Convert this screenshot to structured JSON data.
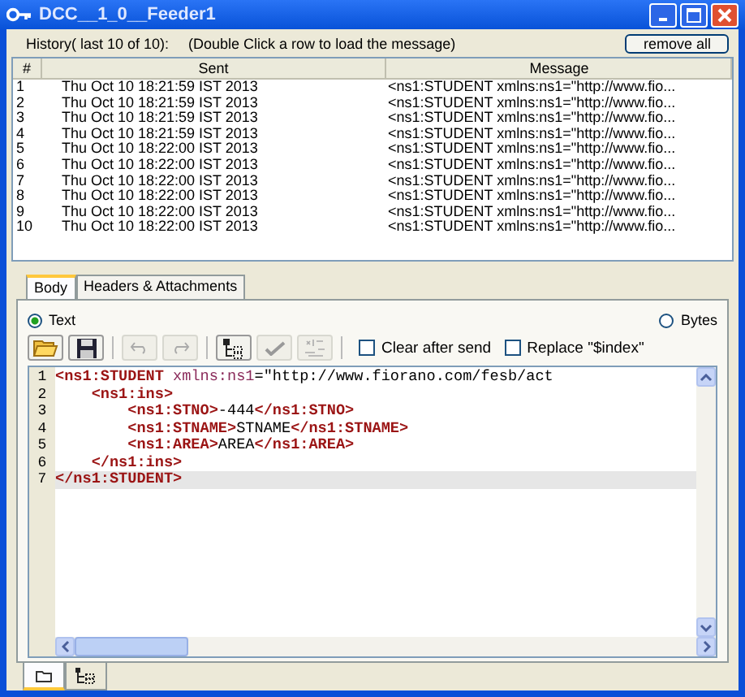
{
  "window": {
    "title": "DCC__1_0__Feeder1",
    "controls": [
      {
        "kind": "minimize"
      },
      {
        "kind": "maximize"
      },
      {
        "kind": "close"
      }
    ]
  },
  "history": {
    "label": "History( last 10 of 10):",
    "hint": "(Double Click a row to load the message)",
    "button": "remove all"
  },
  "table": {
    "columns": [
      "#",
      "Sent",
      "Message"
    ],
    "rows": [
      {
        "num": "1",
        "sent": "Thu Oct 10 18:21:59 IST 2013",
        "message": "<ns1:STUDENT xmlns:ns1=\"http://www.fio..."
      },
      {
        "num": "2",
        "sent": "Thu Oct 10 18:21:59 IST 2013",
        "message": "<ns1:STUDENT xmlns:ns1=\"http://www.fio..."
      },
      {
        "num": "3",
        "sent": "Thu Oct 10 18:21:59 IST 2013",
        "message": "<ns1:STUDENT xmlns:ns1=\"http://www.fio..."
      },
      {
        "num": "4",
        "sent": "Thu Oct 10 18:21:59 IST 2013",
        "message": "<ns1:STUDENT xmlns:ns1=\"http://www.fio..."
      },
      {
        "num": "5",
        "sent": "Thu Oct 10 18:22:00 IST 2013",
        "message": "<ns1:STUDENT xmlns:ns1=\"http://www.fio..."
      },
      {
        "num": "6",
        "sent": "Thu Oct 10 18:22:00 IST 2013",
        "message": "<ns1:STUDENT xmlns:ns1=\"http://www.fio..."
      },
      {
        "num": "7",
        "sent": "Thu Oct 10 18:22:00 IST 2013",
        "message": "<ns1:STUDENT xmlns:ns1=\"http://www.fio..."
      },
      {
        "num": "8",
        "sent": "Thu Oct 10 18:22:00 IST 2013",
        "message": "<ns1:STUDENT xmlns:ns1=\"http://www.fio..."
      },
      {
        "num": "9",
        "sent": "Thu Oct 10 18:22:00 IST 2013",
        "message": "<ns1:STUDENT xmlns:ns1=\"http://www.fio..."
      },
      {
        "num": "10",
        "sent": "Thu Oct 10 18:22:00 IST 2013",
        "message": "<ns1:STUDENT xmlns:ns1=\"http://www.fio..."
      }
    ]
  },
  "tabs": [
    {
      "label": "Body",
      "selected": true
    },
    {
      "label": "Headers & Attachments",
      "selected": false
    }
  ],
  "format": [
    {
      "label": "Text",
      "selected": true
    },
    {
      "label": "Bytes",
      "selected": false
    }
  ],
  "toolbar": [
    {
      "kind": "open",
      "disabled": false
    },
    {
      "kind": "save",
      "disabled": false
    },
    {
      "kind": "sep"
    },
    {
      "kind": "undo",
      "disabled": true
    },
    {
      "kind": "redo",
      "disabled": true
    },
    {
      "kind": "sep"
    },
    {
      "kind": "tree",
      "disabled": false
    },
    {
      "kind": "check",
      "disabled": true
    },
    {
      "kind": "convert",
      "disabled": true
    },
    {
      "kind": "sep"
    }
  ],
  "options": [
    {
      "label": "Clear after send",
      "checked": false
    },
    {
      "label": "Replace \"$index\"",
      "checked": false
    }
  ],
  "editor": {
    "lines": [
      {
        "num": "1",
        "highlighted": false,
        "tokens": [
          {
            "kind": "tag",
            "text": "<ns1:STUDENT"
          },
          {
            "kind": "attr",
            "text": " xmlns:ns1"
          },
          {
            "kind": "text",
            "text": "=\"http://www.fiorano.com/fesb/act"
          }
        ],
        "children": [
          {
            "num": "2",
            "highlighted": false,
            "tokens": [
              {
                "kind": "tag",
                "text": "<ns1:ins>"
              }
            ],
            "children": [
              {
                "num": "3",
                "highlighted": false,
                "tokens": [
                  {
                    "kind": "tag",
                    "text": "<ns1:STNO>"
                  },
                  {
                    "kind": "text",
                    "text": "-444"
                  },
                  {
                    "kind": "tag",
                    "text": "</ns1:STNO>"
                  }
                ]
              },
              {
                "num": "4",
                "highlighted": false,
                "tokens": [
                  {
                    "kind": "tag",
                    "text": "<ns1:STNAME>"
                  },
                  {
                    "kind": "text",
                    "text": "STNAME"
                  },
                  {
                    "kind": "tag",
                    "text": "</ns1:STNAME>"
                  }
                ]
              },
              {
                "num": "5",
                "highlighted": false,
                "tokens": [
                  {
                    "kind": "tag",
                    "text": "<ns1:AREA>"
                  },
                  {
                    "kind": "text",
                    "text": "AREA"
                  },
                  {
                    "kind": "tag",
                    "text": "</ns1:AREA>"
                  }
                ]
              }
            ]
          },
          {
            "num": "6",
            "highlighted": false,
            "tokens": [
              {
                "kind": "tag",
                "text": "</ns1:ins>"
              }
            ]
          }
        ]
      },
      {
        "num": "7",
        "highlighted": true,
        "tokens": [
          {
            "kind": "tag",
            "text": "</ns1:STUDENT>"
          }
        ]
      }
    ]
  },
  "view_tabs": [
    {
      "kind": "document",
      "selected": true
    },
    {
      "kind": "tree",
      "selected": false
    }
  ]
}
